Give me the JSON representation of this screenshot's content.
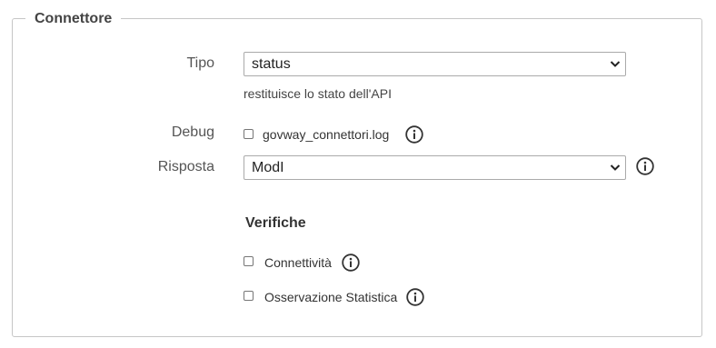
{
  "legend": "Connettore",
  "tipo": {
    "label": "Tipo",
    "value": "status",
    "description": "restituisce lo stato dell'API"
  },
  "debug": {
    "label": "Debug",
    "checkbox_label": "govway_connettori.log",
    "checked": false
  },
  "risposta": {
    "label": "Risposta",
    "value": "ModI"
  },
  "verifiche": {
    "title": "Verifiche",
    "items": [
      {
        "label": "Connettività",
        "checked": false
      },
      {
        "label": "Osservazione Statistica",
        "checked": false
      }
    ]
  },
  "icons": {
    "info": "info-circle-icon",
    "dropdown": "chevron-down-icon"
  }
}
